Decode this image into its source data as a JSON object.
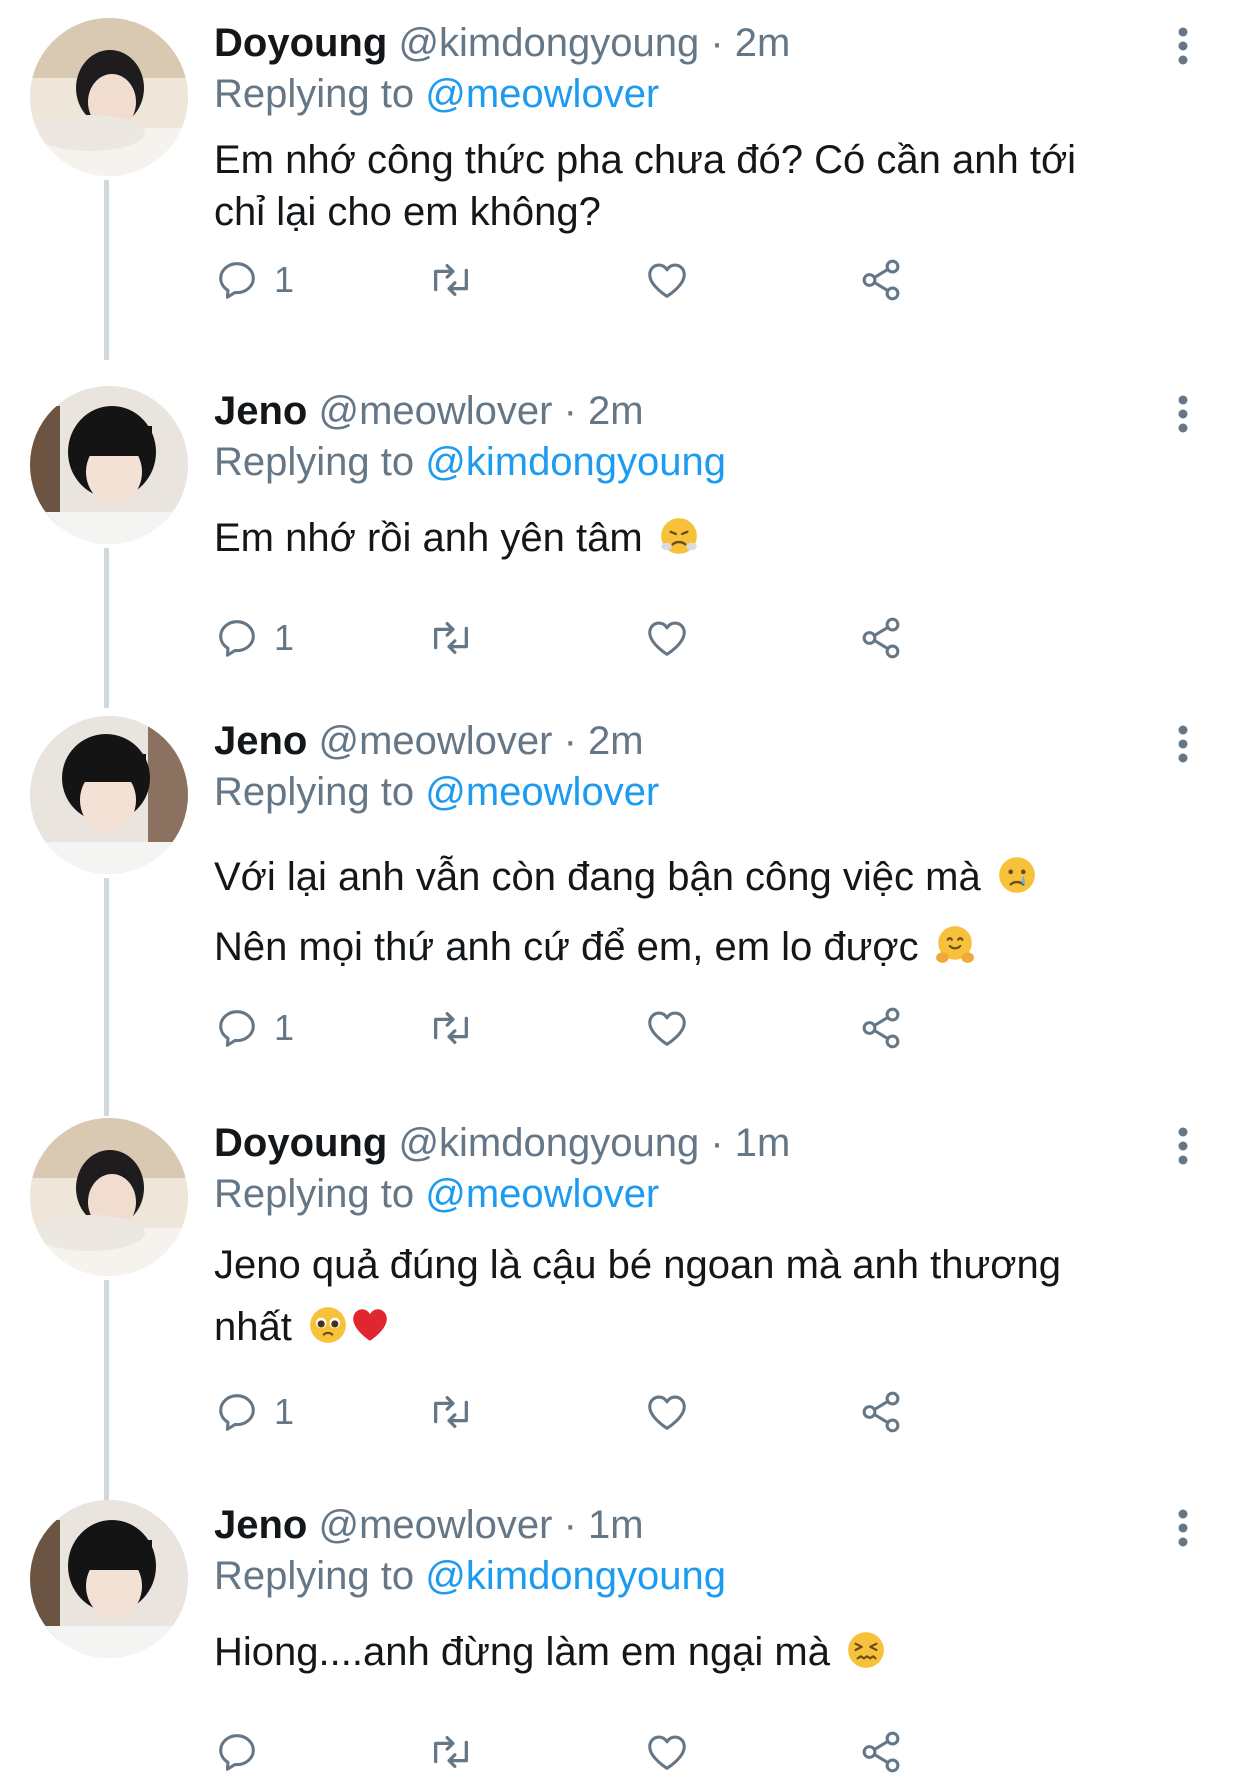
{
  "colors": {
    "accent": "#1d9bf0",
    "secondary_text": "#657786",
    "primary_text": "#14171a",
    "thread_line": "#cfd9de"
  },
  "tweets": [
    {
      "name": "Doyoung",
      "handle": "@kimdongyoung",
      "time": "· 2m",
      "replying_prefix": "Replying to",
      "replying_to": "@meowlover",
      "lines": [
        "Em nhớ công thức pha chưa đó? Có cần anh tới",
        "chỉ lại cho em không?"
      ],
      "reply_count": "1",
      "emoji": []
    },
    {
      "name": "Jeno",
      "handle": "@meowlover",
      "time": "· 2m",
      "replying_prefix": "Replying to",
      "replying_to": "@kimdongyoung",
      "lines": [
        "Em nhớ rồi anh yên tâm"
      ],
      "reply_count": "1",
      "emoji": [
        "face-with-steam-from-nose"
      ]
    },
    {
      "name": "Jeno",
      "handle": "@meowlover",
      "time": "· 2m",
      "replying_prefix": "Replying to",
      "replying_to": "@meowlover",
      "lines": [
        "Với lại anh vẫn còn đang bận công việc mà",
        "Nên mọi thứ anh cứ để em, em lo được"
      ],
      "reply_count": "1",
      "emoji": [
        "crying-face",
        "hugging-face"
      ]
    },
    {
      "name": "Doyoung",
      "handle": "@kimdongyoung",
      "time": "· 1m",
      "replying_prefix": "Replying to",
      "replying_to": "@meowlover",
      "lines": [
        "Jeno quả đúng là cậu bé ngoan mà anh thương",
        "nhất"
      ],
      "reply_count": "1",
      "emoji": [
        "pleading-face",
        "red-heart"
      ]
    },
    {
      "name": "Jeno",
      "handle": "@meowlover",
      "time": "· 1m",
      "replying_prefix": "Replying to",
      "replying_to": "@kimdongyoung",
      "lines": [
        "Hiong....anh đừng làm em ngại mà"
      ],
      "reply_count": "",
      "emoji": [
        "confounded-face"
      ]
    }
  ]
}
